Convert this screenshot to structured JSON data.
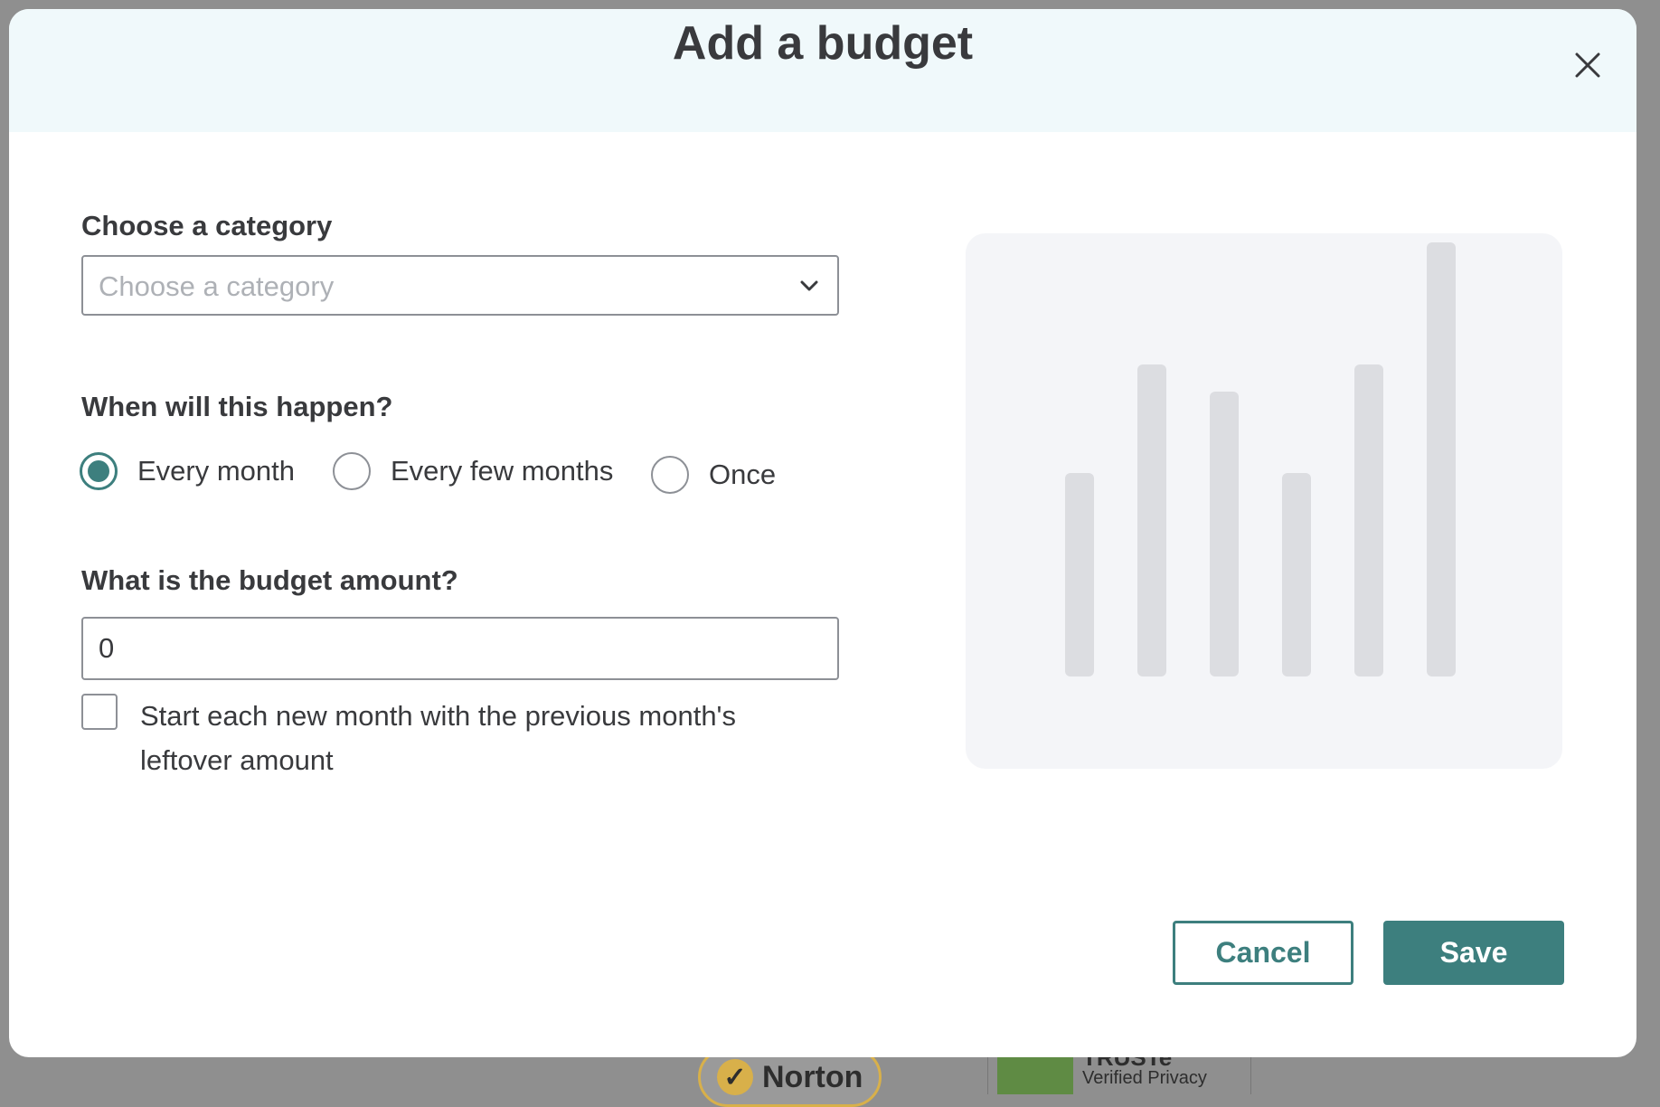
{
  "modal": {
    "title": "Add a budget",
    "close_icon": "close-icon"
  },
  "category": {
    "label": "Choose a category",
    "placeholder": "Choose a category",
    "chevron_icon": "chevron-down-icon"
  },
  "frequency": {
    "label": "When will this happen?",
    "options": [
      {
        "label": "Every month",
        "selected": true
      },
      {
        "label": "Every few months",
        "selected": false
      },
      {
        "label": "Once",
        "selected": false
      }
    ]
  },
  "amount": {
    "label": "What is the budget amount?",
    "value": "0"
  },
  "rollover": {
    "label": "Start each new month with the previous month's leftover amount",
    "checked": false
  },
  "illustration": {
    "relative_values": [
      0.3,
      0.46,
      0.42,
      0.3,
      0.46,
      0.64
    ]
  },
  "actions": {
    "cancel_label": "Cancel",
    "save_label": "Save"
  },
  "colors": {
    "accent": "#3d7f7e",
    "header_bg": "#f0f9fb",
    "placeholder_bar": "#dcdde1"
  }
}
